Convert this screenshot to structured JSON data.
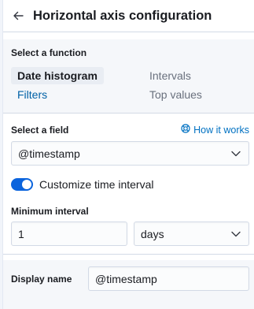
{
  "header": {
    "title": "Horizontal axis configuration"
  },
  "function_section": {
    "label": "Select a function",
    "options": [
      {
        "label": "Date histogram",
        "state": "selected"
      },
      {
        "label": "Intervals",
        "state": "disabled"
      },
      {
        "label": "Filters",
        "state": "link"
      },
      {
        "label": "Top values",
        "state": "disabled"
      }
    ]
  },
  "field_section": {
    "label": "Select a field",
    "help_link": "How it works",
    "selected_value": "@timestamp"
  },
  "toggle": {
    "label": "Customize time interval",
    "checked": true
  },
  "interval_section": {
    "label": "Minimum interval",
    "value": "1",
    "unit": "days"
  },
  "display_name": {
    "label": "Display name",
    "value": "@timestamp"
  },
  "colors": {
    "accent": "#0b64dd",
    "link": "#0061a6"
  }
}
